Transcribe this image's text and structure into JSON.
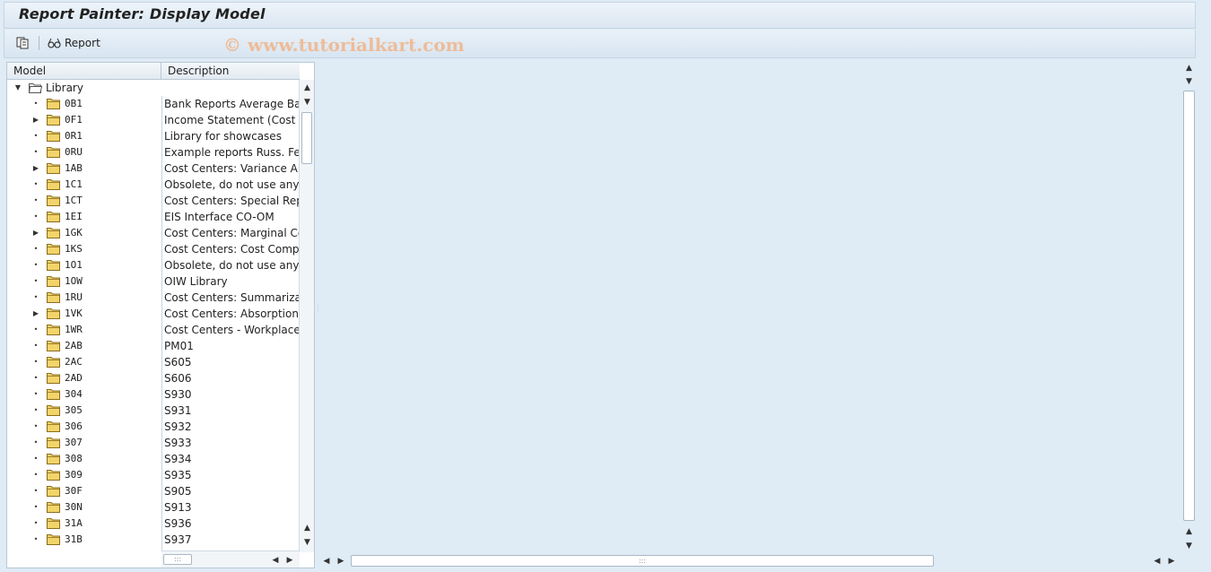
{
  "window": {
    "title": "Report Painter: Display Model"
  },
  "toolbar": {
    "report_label": "Report",
    "watermark": "© www.tutorialkart.com",
    "icons": [
      "display-change-icon",
      "report-glasses-icon"
    ]
  },
  "tree": {
    "columns": {
      "model": "Model",
      "description": "Description"
    },
    "root": {
      "label": "Library",
      "expanded": true
    },
    "items": [
      {
        "code": "0B1",
        "description": "Bank Reports Average Balan",
        "expandable": false
      },
      {
        "code": "0F1",
        "description": "Income Statement (Cost of",
        "expandable": true
      },
      {
        "code": "0R1",
        "description": "Library for showcases",
        "expandable": false
      },
      {
        "code": "0RU",
        "description": "Example reports Russ. Fede",
        "expandable": false
      },
      {
        "code": "1AB",
        "description": "Cost Centers: Variance Anal",
        "expandable": true
      },
      {
        "code": "1C1",
        "description": "Obsolete, do not use anymo",
        "expandable": false
      },
      {
        "code": "1CT",
        "description": "Cost Centers: Special Repor",
        "expandable": false
      },
      {
        "code": "1EI",
        "description": "EIS Interface CO-OM",
        "expandable": false
      },
      {
        "code": "1GK",
        "description": "Cost Centers: Marginal Costi",
        "expandable": true
      },
      {
        "code": "1KS",
        "description": "Cost Centers: Cost Compon",
        "expandable": false
      },
      {
        "code": "1O1",
        "description": "Obsolete, do not use anymo",
        "expandable": false
      },
      {
        "code": "1OW",
        "description": "OIW Library",
        "expandable": false
      },
      {
        "code": "1RU",
        "description": "Cost Centers: Summarization",
        "expandable": false
      },
      {
        "code": "1VK",
        "description": "Cost Centers: Absorption Co",
        "expandable": true
      },
      {
        "code": "1WR",
        "description": "Cost Centers - Workplace Re",
        "expandable": false
      },
      {
        "code": "2AB",
        "description": "PM01",
        "expandable": false
      },
      {
        "code": "2AC",
        "description": "S605",
        "expandable": false
      },
      {
        "code": "2AD",
        "description": "S606",
        "expandable": false
      },
      {
        "code": "304",
        "description": "S930",
        "expandable": false
      },
      {
        "code": "305",
        "description": "S931",
        "expandable": false
      },
      {
        "code": "306",
        "description": "S932",
        "expandable": false
      },
      {
        "code": "307",
        "description": "S933",
        "expandable": false
      },
      {
        "code": "308",
        "description": "S934",
        "expandable": false
      },
      {
        "code": "309",
        "description": "S935",
        "expandable": false
      },
      {
        "code": "30F",
        "description": "S905",
        "expandable": false
      },
      {
        "code": "30N",
        "description": "S913",
        "expandable": false
      },
      {
        "code": "31A",
        "description": "S936",
        "expandable": false
      },
      {
        "code": "31B",
        "description": "S937",
        "expandable": false
      }
    ]
  },
  "colors": {
    "background": "#dfebf5",
    "border": "#b7c8d8",
    "folder": "#f3d46a",
    "watermark": "#f0b58a"
  }
}
